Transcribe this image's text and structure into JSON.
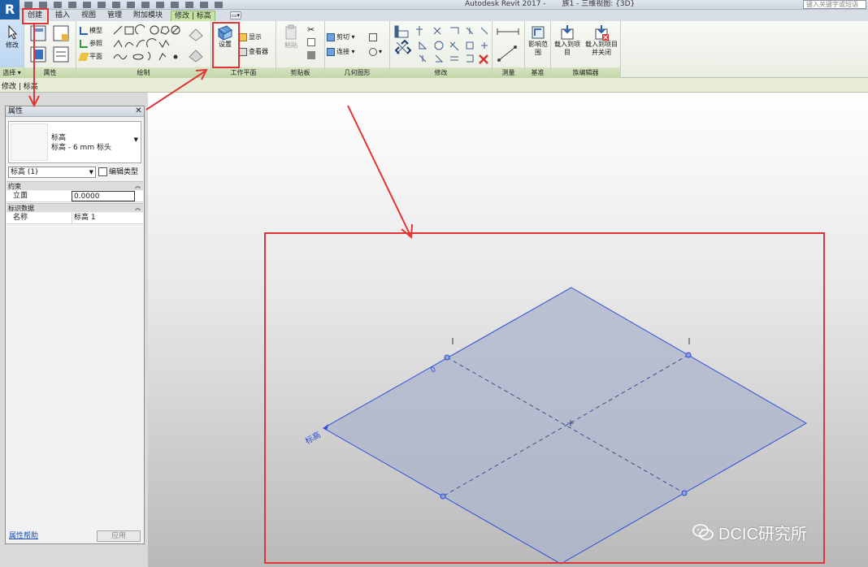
{
  "window": {
    "app_title": "Autodesk Revit 2017 -",
    "doc_title": "族1 - 三维视图: {3D}",
    "search_placeholder": "键入关键字或短语"
  },
  "ribbon_tabs": [
    {
      "label": "创建",
      "active": false
    },
    {
      "label": "插入",
      "active": false
    },
    {
      "label": "视图",
      "active": false
    },
    {
      "label": "管理",
      "active": false
    },
    {
      "label": "附加模块",
      "active": false
    },
    {
      "label": "修改 | 标高",
      "active": true
    }
  ],
  "ribbon": {
    "select_panel": {
      "modify_label": "修改",
      "label": "选择 ▾"
    },
    "properties_panel": {
      "label": "属性"
    },
    "draw_panel": {
      "label": "绘制",
      "items": [
        "模型",
        "参照",
        "平面"
      ]
    },
    "workplane_panel": {
      "label": "工作平面",
      "set_label": "设置",
      "show_label": "显示",
      "viewer_label": "查看器"
    },
    "clipboard_panel": {
      "label": "剪贴板",
      "paste_label": "粘贴"
    },
    "geometry_panel": {
      "label": "几何图形",
      "cut_label": "剪切",
      "join_label": "连接"
    },
    "modify_panel": {
      "label": "修改"
    },
    "measure_panel": {
      "label": "测量"
    },
    "datum_panel": {
      "label": "基准",
      "scope_label": "影响范围"
    },
    "family_editor_panel": {
      "label": "族编辑器",
      "load_label": "载入到项目",
      "load_close_label": "载入到项目并关闭"
    }
  },
  "context_bar": {
    "text": "修改 | 标高"
  },
  "properties": {
    "title": "属性",
    "type_name": "标高",
    "type_sub": "标高 - 6 mm 标头",
    "instance_selector": "标高 (1)",
    "edit_type": "编辑类型",
    "groups": [
      {
        "name": "约束",
        "rows": [
          {
            "key": "立面",
            "value": "0.0000"
          }
        ]
      },
      {
        "name": "标识数据",
        "rows": [
          {
            "key": "名称",
            "value": "标高 1"
          }
        ]
      }
    ],
    "help_link": "属性帮助",
    "apply_button": "应用"
  },
  "viewport": {
    "level_label": "标高",
    "level_value": "0"
  },
  "watermark": {
    "text": "DCIC研究所"
  },
  "colors": {
    "annotation_red": "#e23434",
    "plane_fill": "#a9b4cc",
    "plane_edge": "#2c4fd6",
    "ribbon_green": "#c8e2a8"
  }
}
